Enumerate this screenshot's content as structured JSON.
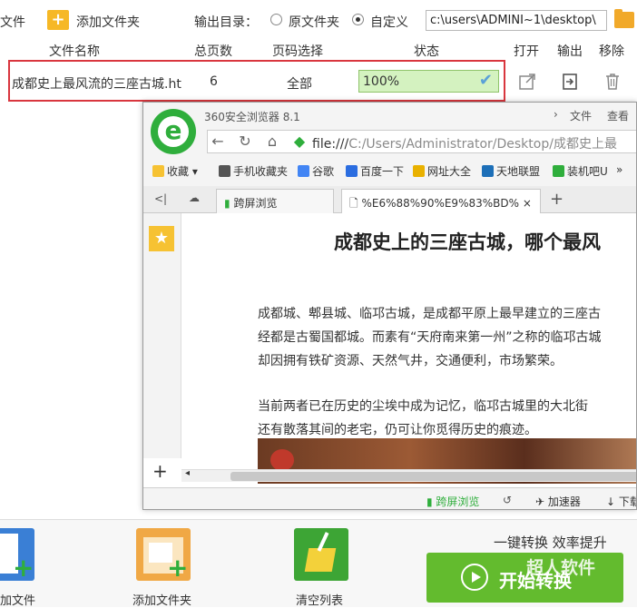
{
  "toolbar": {
    "add_file_partial": "文件",
    "add_folder_label": "添加文件夹",
    "output_label": "输出目录：",
    "radio_original": "原文件夹",
    "radio_custom": "自定义",
    "output_path": "c:\\users\\ADMINI~1\\desktop\\"
  },
  "table": {
    "headers": [
      "文件名称",
      "总页数",
      "页码选择",
      "状态",
      "打开",
      "输出",
      "移除"
    ],
    "rows": [
      {
        "name": "成都史上最风流的三座古城.ht",
        "pages": "6",
        "range": "全部",
        "status": "100%"
      }
    ]
  },
  "browser": {
    "app_title": "360安全浏览器 8.1",
    "menu_file": "文件",
    "menu_view": "查看",
    "url_prefix": "file:///",
    "url_rest": "C:/Users/Administrator/Desktop/成都史上最",
    "bookmarks": [
      "收藏",
      "手机收藏夹",
      "谷歌",
      "百度一下",
      "网址大全",
      "天地联盟",
      "装机吧U"
    ],
    "tabs": [
      "跨屏浏览",
      "%E6%88%90%E9%83%BD%"
    ],
    "article_title": "成都史上的三座古城，哪个最风",
    "paragraphs": [
      "成都城、郫县城、临邛古城，是成都平原上最早建立的三座古",
      "经都是古蜀国都城。而素有“天府南来第一州”之称的临邛古城",
      "却因拥有铁矿资源、天然气井，交通便利，市场繁荣。",
      "当前两者已在历史的尘埃中成为记忆，临邛古城里的大北街",
      "还有散落其间的老宅，仍可让你觅得历史的痕迹。"
    ],
    "status_items": [
      "跨屏浏览",
      "加速器",
      "下载"
    ]
  },
  "bottom": {
    "add_file_label": "加文件",
    "add_folder_label": "添加文件夹",
    "clear_label": "清空列表",
    "slogan": "一键转换  效率提升",
    "start_label": "开始转换",
    "watermark": "超人软件"
  },
  "colors": {
    "accent_green": "#63bb2e",
    "highlight_red": "#d9363e",
    "progress_fill": "#d4f2c0",
    "logo_green": "#2fae3c"
  }
}
